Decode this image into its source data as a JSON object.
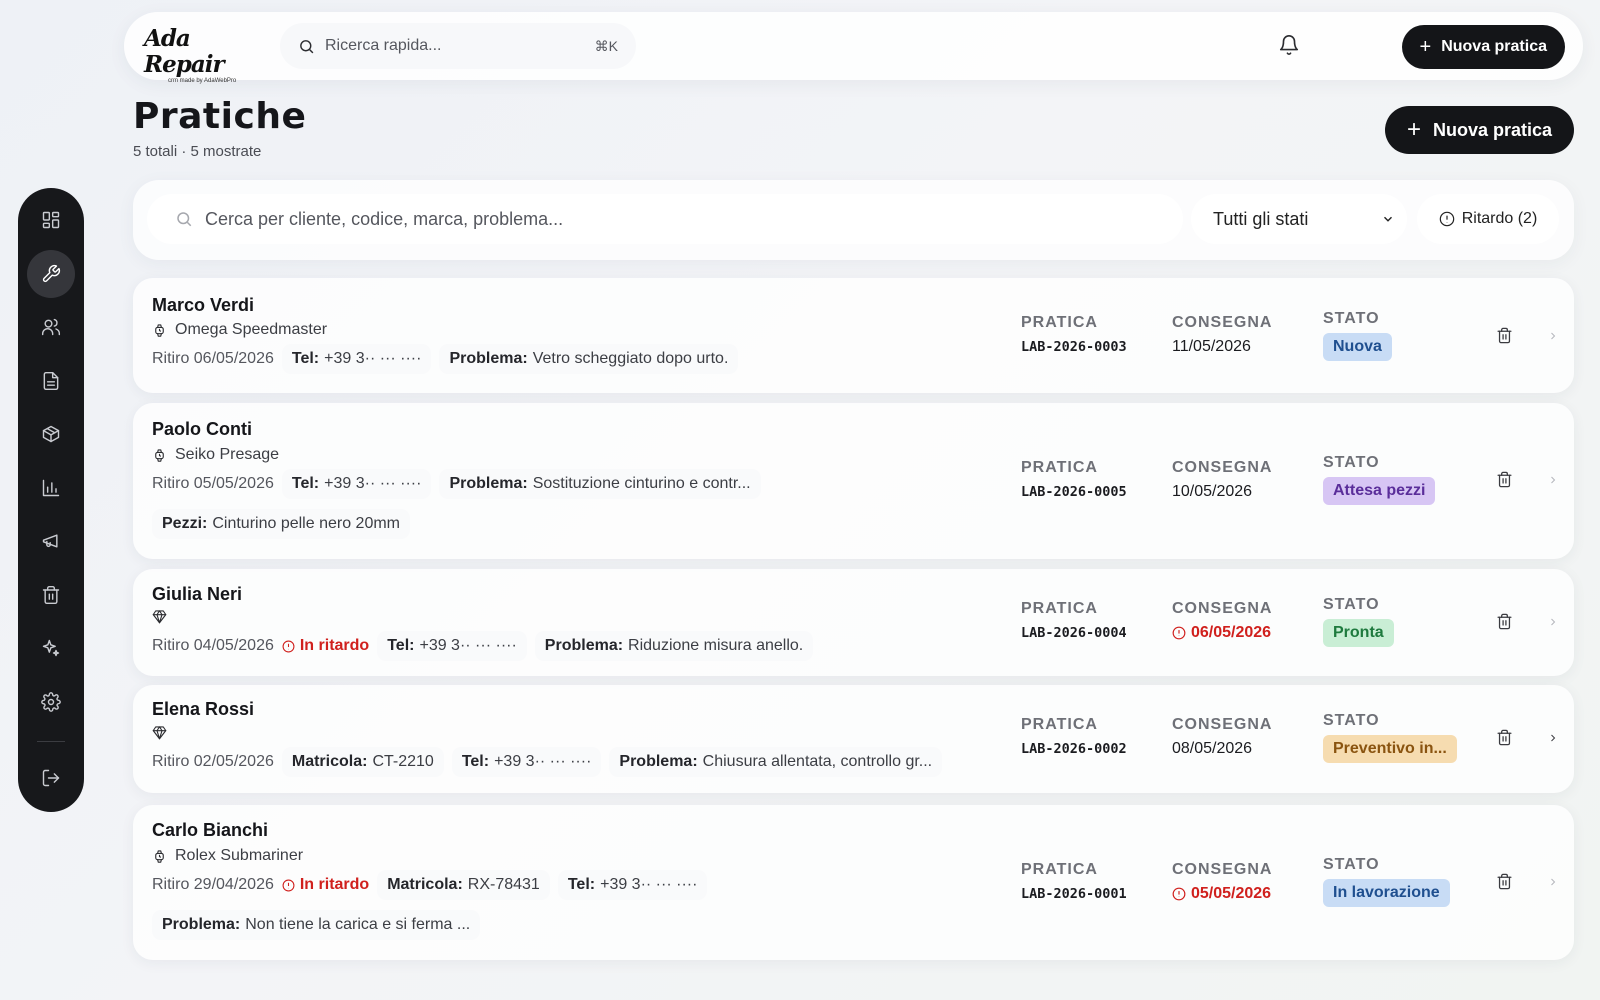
{
  "brand": {
    "logo_text": "Ada Repair",
    "logo_sub": "crm made by AdaWebPro"
  },
  "topbar": {
    "search_placeholder": "Ricerca rapida...",
    "search_shortcut": "⌘K",
    "new_button_label": "Nuova pratica",
    "new_button_icon": "plus-icon",
    "notification_icon": "bell-icon"
  },
  "sidebar": {
    "items": [
      {
        "id": "dashboard",
        "icon": "grid-icon",
        "active": false
      },
      {
        "id": "repairs",
        "icon": "wrench-icon",
        "active": true
      },
      {
        "id": "customers",
        "icon": "users-icon",
        "active": false
      },
      {
        "id": "documents",
        "icon": "document-icon",
        "active": false
      },
      {
        "id": "inventory",
        "icon": "box-icon",
        "active": false
      },
      {
        "id": "reports",
        "icon": "bar-chart-icon",
        "active": false
      },
      {
        "id": "marketing",
        "icon": "megaphone-icon",
        "active": false
      },
      {
        "id": "trash",
        "icon": "trash-icon",
        "active": false
      },
      {
        "id": "ai",
        "icon": "sparkles-icon",
        "active": false
      },
      {
        "id": "settings",
        "icon": "gear-icon",
        "active": false
      }
    ],
    "logout_icon": "logout-icon"
  },
  "page": {
    "title": "Pratiche",
    "subtitle": "5 totali · 5 mostrate",
    "new_button_label": "Nuova pratica"
  },
  "filters": {
    "search_placeholder": "Cerca per cliente, codice, marca, problema...",
    "status_selected": "Tutti gli stati",
    "late_label": "Ritardo (2)"
  },
  "labels": {
    "pratica": "PRATICA",
    "consegna": "CONSEGNA",
    "stato": "STATO",
    "problema": "Problema:",
    "tel": "Tel:",
    "matricola": "Matricola:",
    "pezzi": "Pezzi:",
    "late": "In ritardo"
  },
  "repairs": [
    {
      "customer": "Marco Verdi",
      "item_icon": "watch-icon",
      "item": "Omega Speedmaster",
      "pickup": "Ritiro 06/05/2026",
      "late": false,
      "serial": "",
      "phone": "+39 3·· ··· ····",
      "problem": "Vetro scheggiato dopo urto.",
      "parts": "",
      "code": "LAB-2026-0003",
      "delivery": "11/05/2026",
      "delivery_late": false,
      "status": "Nuova",
      "status_bg": "#c8dcf5",
      "status_fg": "#1f4f8f"
    },
    {
      "customer": "Paolo Conti",
      "item_icon": "watch-icon",
      "item": "Seiko Presage",
      "pickup": "Ritiro 05/05/2026",
      "late": false,
      "serial": "",
      "phone": "+39 3·· ··· ····",
      "problem": "Sostituzione cinturino e contr...",
      "parts": "Cinturino pelle nero 20mm",
      "code": "LAB-2026-0005",
      "delivery": "10/05/2026",
      "delivery_late": false,
      "status": "Attesa pezzi",
      "status_bg": "#d7c6f4",
      "status_fg": "#5a2d9a"
    },
    {
      "customer": "Giulia Neri",
      "item_icon": "diamond-icon",
      "item": "",
      "pickup": "Ritiro 04/05/2026",
      "late": true,
      "serial": "",
      "phone": "+39 3·· ··· ····",
      "problem": "Riduzione misura anello.",
      "parts": "",
      "code": "LAB-2026-0004",
      "delivery": "06/05/2026",
      "delivery_late": true,
      "status": "Pronta",
      "status_bg": "#c9eed5",
      "status_fg": "#1e7a3e"
    },
    {
      "customer": "Elena Rossi",
      "item_icon": "diamond-icon",
      "item": "",
      "pickup": "Ritiro 02/05/2026",
      "late": false,
      "serial": "CT-2210",
      "phone": "+39 3·· ··· ····",
      "problem": "Chiusura allentata, controllo gr...",
      "parts": "",
      "code": "LAB-2026-0002",
      "delivery": "08/05/2026",
      "delivery_late": false,
      "status": "Preventivo in...",
      "status_bg": "#f6dcb0",
      "status_fg": "#8a5410"
    },
    {
      "customer": "Carlo Bianchi",
      "item_icon": "watch-icon",
      "item": "Rolex Submariner",
      "pickup": "Ritiro 29/04/2026",
      "late": true,
      "serial": "RX-78431",
      "phone": "+39 3·· ··· ····",
      "problem": "Non tiene la carica e si ferma ...",
      "parts": "",
      "code": "LAB-2026-0001",
      "delivery": "05/05/2026",
      "delivery_late": true,
      "status": "In lavorazione",
      "status_bg": "#c8dcf5",
      "status_fg": "#1f4f8f"
    }
  ]
}
